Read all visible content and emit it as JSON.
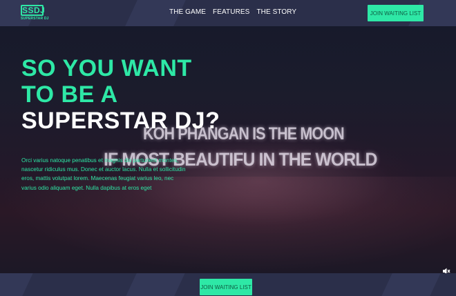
{
  "brand": {
    "logo_text": "SSDJ",
    "logo_subtitle": "SUPERSTAR DJ",
    "accent_color": "#2ee8a6",
    "bar_color": "#2b2f4a"
  },
  "nav": {
    "items": [
      {
        "label": "THE GAME"
      },
      {
        "label": "FEATURES"
      },
      {
        "label": "THE STORY"
      }
    ],
    "cta_label": "JOIN WAITING LIST"
  },
  "hero": {
    "headline_line1": "SO YOU WANT",
    "headline_line2": "TO BE A",
    "headline_line3": "SUPERSTAR DJ?",
    "description": "Orci varius natoque penatibus et magnis dis parturient montes, nascetur ridiculus mus. Donec et auctor lacus. Nulla et sollicitudin eros, mattis volutpat lorem. Maecenas feugiat varius leo, nec varius odio aliquam eget. Nulla dapibus at eros eget",
    "background_sign_line1": "KOH PHANGAN IS THE MOON",
    "background_sign_line2": "IF MOST BEAUTIFU  IN THE WORLD",
    "mute_icon": "muted-speaker-icon"
  },
  "footer": {
    "cta_label": "JOIN WAITING LIST"
  }
}
